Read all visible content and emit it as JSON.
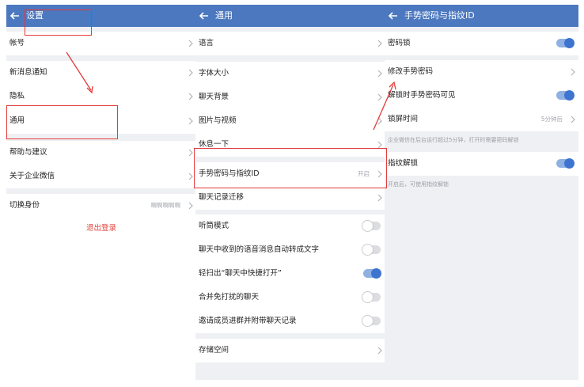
{
  "screen1": {
    "title": "设置",
    "items": [
      {
        "label": "帐号",
        "value": ""
      },
      {
        "label": "新消息通知",
        "value": ""
      },
      {
        "label": "隐私",
        "value": ""
      },
      {
        "label": "通用",
        "value": ""
      },
      {
        "label": "帮助与建议",
        "value": ""
      },
      {
        "label": "关于企业微信",
        "value": ""
      },
      {
        "label": "切换身份",
        "value": "啊啊啊啊啊"
      }
    ],
    "logout_label": "退出登录"
  },
  "screen2": {
    "title": "通用",
    "items": [
      {
        "label": "语言",
        "control": "chevron"
      },
      {
        "label": "字体大小",
        "control": "chevron"
      },
      {
        "label": "聊天背景",
        "control": "chevron"
      },
      {
        "label": "图片与视频",
        "control": "chevron"
      },
      {
        "label": "休息一下",
        "control": "chevron"
      },
      {
        "label": "手势密码与指纹ID",
        "value": "开启",
        "control": "chevron"
      },
      {
        "label": "聊天记录迁移",
        "control": "chevron"
      },
      {
        "label": "听筒模式",
        "control": "toggle",
        "on": false
      },
      {
        "label": "聊天中收到的语音消息自动转成文字",
        "control": "toggle",
        "on": false
      },
      {
        "label": "轻扫出“聊天中快捷打开”",
        "control": "toggle",
        "on": true
      },
      {
        "label": "合并免打扰的聊天",
        "control": "toggle",
        "on": false
      },
      {
        "label": "邀请成员进群并附带聊天记录",
        "control": "toggle",
        "on": false
      },
      {
        "label": "存储空间",
        "control": "chevron"
      }
    ]
  },
  "screen3": {
    "title": "手势密码与指纹ID",
    "items": [
      {
        "label": "密码锁",
        "control": "toggle",
        "on": true
      },
      {
        "label": "修改手势密码",
        "control": "chevron"
      },
      {
        "label": "解锁时手势密码可见",
        "control": "toggle",
        "on": true
      },
      {
        "label": "锁屏时间",
        "value": "5分钟后",
        "control": "chevron"
      },
      {
        "label": "指纹解锁",
        "control": "toggle",
        "on": true
      }
    ],
    "lock_note": "企业微信在后台运行超过5分钟，打开时需要密码解锁",
    "fingerprint_note": "开启后，可使用指纹解锁"
  },
  "colors": {
    "header": "#4c78bf",
    "toggle_on": "#3e74cf",
    "logout": "#e2413a",
    "annotation": "#e33b3b",
    "background": "#eff0f3"
  }
}
